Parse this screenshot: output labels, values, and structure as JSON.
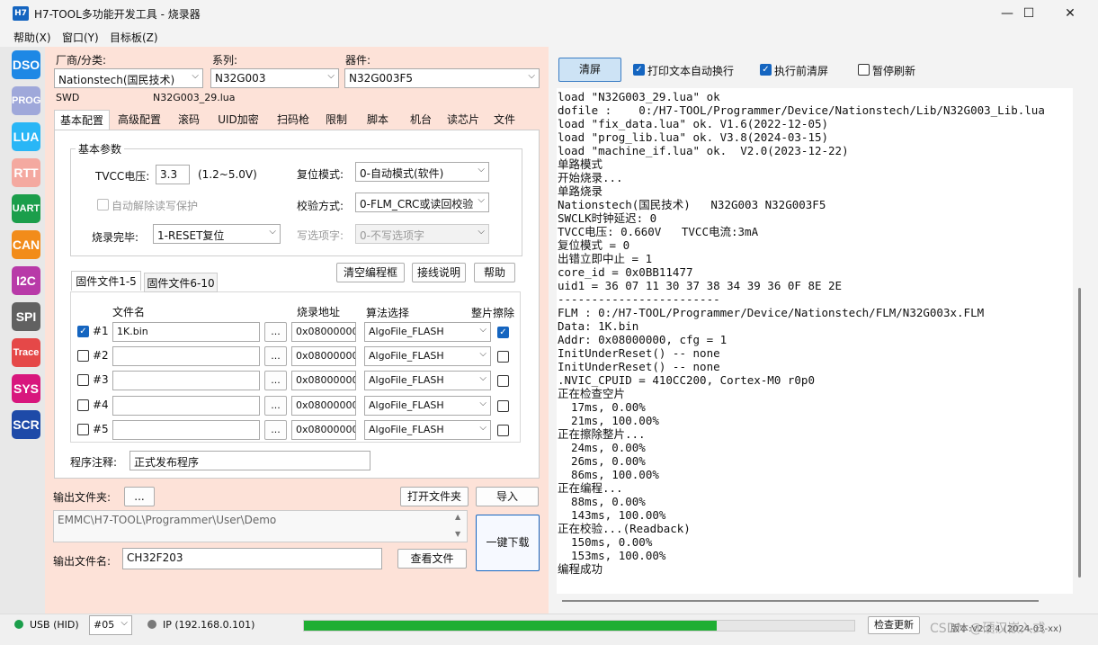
{
  "window": {
    "icon_text": "H7",
    "title": "H7-TOOL多功能开发工具 - 烧录器",
    "minimize": "—",
    "maximize": "☐",
    "close": "✕"
  },
  "menu": [
    "帮助(X)",
    "窗口(Y)",
    "目标板(Z)"
  ],
  "sidebar": [
    {
      "label": "DSO",
      "color": "#1e88e5"
    },
    {
      "label": "PROG",
      "color": "#9fa8da"
    },
    {
      "label": "LUA",
      "color": "#29b6f6"
    },
    {
      "label": "RTT",
      "color": "#f4a9a0"
    },
    {
      "label": "UART",
      "color": "#1b9e4b"
    },
    {
      "label": "CAN",
      "color": "#f28c1a"
    },
    {
      "label": "I2C",
      "color": "#b83aa8"
    },
    {
      "label": "SPI",
      "color": "#616161"
    },
    {
      "label": "Trace",
      "color": "#e54848"
    },
    {
      "label": "SYS",
      "color": "#d8177d"
    },
    {
      "label": "SCR",
      "color": "#1e4aa8"
    }
  ],
  "selectors": {
    "vendor_label": "厂商/分类:",
    "vendor_value": "Nationstech(国民技术)",
    "series_label": "系列:",
    "series_value": "N32G003",
    "device_label": "器件:",
    "device_value": "N32G003F5",
    "interface": "SWD",
    "lua_file": "N32G003_29.lua"
  },
  "tabs": [
    "基本配置",
    "高级配置",
    "滚码",
    "UID加密",
    "扫码枪",
    "限制",
    "脚本",
    "机台",
    "读芯片",
    "文件"
  ],
  "basic": {
    "group_title": "基本参数",
    "tvcc_label": "TVCC电压:",
    "tvcc_value": "3.3",
    "tvcc_range": "(1.2~5.0V)",
    "auto_unprotect": "自动解除读写保护",
    "after_label": "烧录完毕:",
    "after_value": "1-RESET复位",
    "reset_label": "复位模式:",
    "reset_value": "0-自动模式(软件)",
    "verify_label": "校验方式:",
    "verify_value": "0-FLM_CRC或读回校验",
    "option_label": "写选项字:",
    "option_value": "0-不写选项字"
  },
  "filebuttons": {
    "clear": "清空编程框",
    "wiring": "接线说明",
    "help": "帮助"
  },
  "filetabs": [
    "固件文件1-5",
    "固件文件6-10"
  ],
  "file_headers": {
    "name": "文件名",
    "addr": "烧录地址",
    "algo": "算法选择",
    "erase": "整片擦除"
  },
  "files": [
    {
      "idx": "#1",
      "checked": true,
      "name": "1K.bin",
      "addr": "0x08000000",
      "algo": "AlgoFile_FLASH",
      "erase": true
    },
    {
      "idx": "#2",
      "checked": false,
      "name": "",
      "addr": "0x08000000",
      "algo": "AlgoFile_FLASH",
      "erase": false
    },
    {
      "idx": "#3",
      "checked": false,
      "name": "",
      "addr": "0x08000000",
      "algo": "AlgoFile_FLASH",
      "erase": false
    },
    {
      "idx": "#4",
      "checked": false,
      "name": "",
      "addr": "0x08000000",
      "algo": "AlgoFile_FLASH",
      "erase": false
    },
    {
      "idx": "#5",
      "checked": false,
      "name": "",
      "addr": "0x08000000",
      "algo": "AlgoFile_FLASH",
      "erase": false
    }
  ],
  "browse_label": "...",
  "note_label": "程序注释:",
  "note_value": "正式发布程序",
  "output": {
    "folder_label": "输出文件夹:",
    "browse": "...",
    "open_folder": "打开文件夹",
    "import": "导入",
    "path": "EMMC\\H7-TOOL\\Programmer\\User\\Demo",
    "filename_label": "输出文件名:",
    "filename_value": "CH32F203",
    "view_file": "查看文件",
    "oneclick": "一键下载"
  },
  "log_toolbar": {
    "clear": "清屏",
    "autowrap": "打印文本自动换行",
    "clear_before": "执行前清屏",
    "pause": "暂停刷新"
  },
  "log_lines": [
    "load \"N32G003_29.lua\" ok",
    "dofile :    0:/H7-TOOL/Programmer/Device/Nationstech/Lib/N32G003_Lib.lua",
    "load \"fix_data.lua\" ok. V1.6(2022-12-05)",
    "load \"prog_lib.lua\" ok. V3.8(2024-03-15)",
    "load \"machine_if.lua\" ok.  V2.0(2023-12-22)",
    "单路模式",
    "开始烧录...",
    "单路烧录",
    "Nationstech(国民技术)   N32G003 N32G003F5",
    "SWCLK时钟延迟: 0",
    "TVCC电压: 0.660V   TVCC电流:3mA",
    "复位模式 = 0",
    "出错立即中止 = 1",
    "core_id = 0x0BB11477",
    "uid1 = 36 07 11 30 37 38 34 39 36 0F 8E 2E",
    "------------------------",
    "FLM : 0:/H7-TOOL/Programmer/Device/Nationstech/FLM/N32G003x.FLM",
    "Data: 1K.bin",
    "Addr: 0x08000000, cfg = 1",
    "InitUnderReset() -- none",
    "InitUnderReset() -- none",
    ".NVIC_CPUID = 410CC200, Cortex-M0 r0p0",
    "正在检查空片",
    "  17ms, 0.00%",
    "  21ms, 100.00%",
    "正在擦除整片...",
    "  24ms, 0.00%",
    "  26ms, 0.00%",
    "  86ms, 100.00%",
    "正在编程...",
    "  88ms, 0.00%",
    "  143ms, 100.00%",
    "正在校验...(Readback)",
    "  150ms, 0.00%",
    "  153ms, 100.00%",
    "编程成功"
  ],
  "status": {
    "usb": "USB (HID)",
    "channel": "#05",
    "ip": "IP (192.168.0.101)",
    "progress": 0.75,
    "check_update": "检查更新",
    "version": "版本:V2.2.4 (2024-03-xx)",
    "watermark": "CSDN @硬汉嵌入式"
  }
}
